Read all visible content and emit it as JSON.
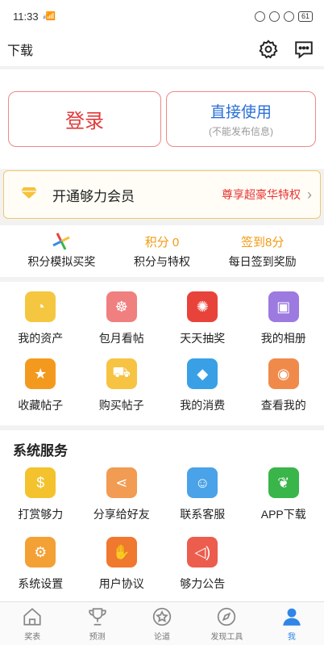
{
  "status": {
    "time": "11:33",
    "signal": "ˢᴵˡ",
    "battery": "61"
  },
  "header": {
    "title": "下载",
    "icons": [
      "gear-icon",
      "message-icon"
    ]
  },
  "login": {
    "login_label": "登录",
    "direct_label": "直接使用",
    "direct_sub": "(不能发布信息)"
  },
  "vip": {
    "label": "开通够力会员",
    "promo": "尊享超豪华特权",
    "arrow": "›"
  },
  "stats": [
    {
      "top": "",
      "label": "积分模拟买奖"
    },
    {
      "top": "积分 0",
      "label": "积分与特权"
    },
    {
      "top": "签到8分",
      "label": "每日签到奖励"
    }
  ],
  "menu": {
    "items": [
      {
        "label": "我的资产",
        "icon": "pie-chart-icon",
        "color": "#f5c640"
      },
      {
        "label": "包月看帖",
        "icon": "meditation-icon",
        "color": "#f07f7f"
      },
      {
        "label": "天天抽奖",
        "icon": "lottery-wheel-icon",
        "color": "#e8433a"
      },
      {
        "label": "我的相册",
        "icon": "photo-icon",
        "color": "#9c7ae0"
      },
      {
        "label": "收藏帖子",
        "icon": "star-icon",
        "color": "#f39a1e"
      },
      {
        "label": "购买帖子",
        "icon": "cart-icon",
        "color": "#f6c343"
      },
      {
        "label": "我的消费",
        "icon": "consume-icon",
        "color": "#3aa0e6"
      },
      {
        "label": "查看我的",
        "icon": "eye-icon",
        "color": "#f08a4b"
      }
    ]
  },
  "services": {
    "title": "系统服务",
    "items": [
      {
        "label": "打赏够力",
        "icon": "money-bag-icon",
        "color": "#f3c22d"
      },
      {
        "label": "分享给好友",
        "icon": "share-icon",
        "color": "#f29b52"
      },
      {
        "label": "联系客服",
        "icon": "qq-icon",
        "color": "#4aa2e8"
      },
      {
        "label": "APP下载",
        "icon": "pepper-icon",
        "color": "#39b54a"
      },
      {
        "label": "系统设置",
        "icon": "settings-icon",
        "color": "#f3a035"
      },
      {
        "label": "用户协议",
        "icon": "handshake-icon",
        "color": "#f0782f"
      },
      {
        "label": "够力公告",
        "icon": "speaker-icon",
        "color": "#ec5d4e"
      }
    ]
  },
  "tabbar": {
    "items": [
      {
        "label": "奖表",
        "icon": "home-icon"
      },
      {
        "label": "预测",
        "icon": "trophy-icon"
      },
      {
        "label": "论道",
        "icon": "star-circle-icon"
      },
      {
        "label": "发现工具",
        "icon": "compass-icon"
      },
      {
        "label": "我",
        "icon": "person-icon",
        "active": true
      }
    ]
  },
  "colors": {
    "accent": "#2f86e6",
    "red": "#e23a3a",
    "orange": "#f29a10",
    "vip_border": "#f1c76c"
  }
}
